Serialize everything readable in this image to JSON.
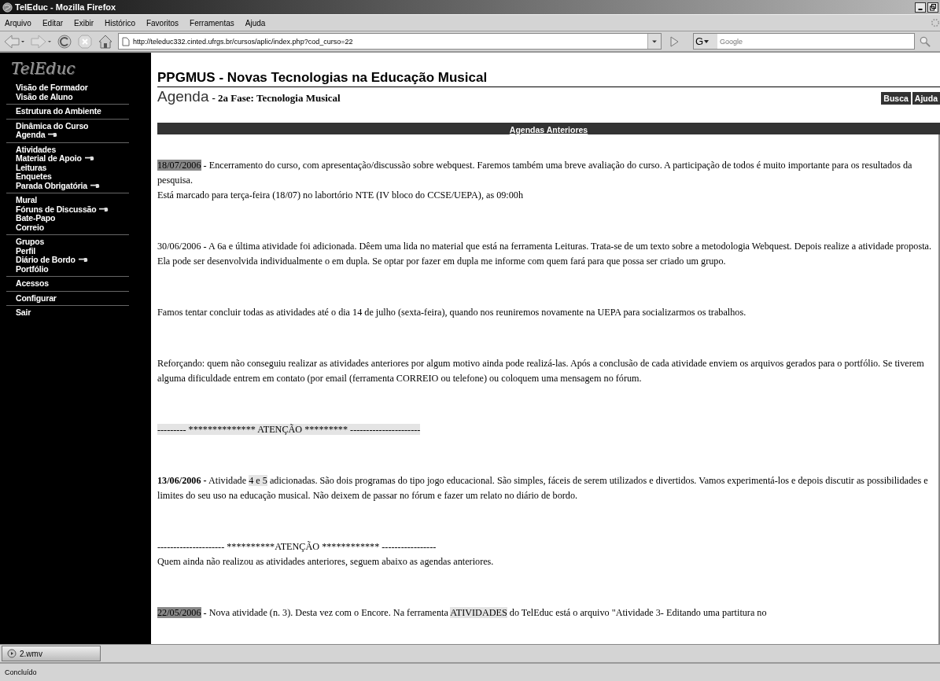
{
  "window": {
    "title": "TelEduc - Mozilla Firefox"
  },
  "menu": [
    "Arquivo",
    "Editar",
    "Exibir",
    "Histórico",
    "Favoritos",
    "Ferramentas",
    "Ajuda"
  ],
  "address": {
    "value": "http://teleduc332.cinted.ufrgs.br/cursos/aplic/index.php?cod_curso=22"
  },
  "search": {
    "engine": "G",
    "placeholder": "Google"
  },
  "sidebar": {
    "logo": "TelEduc",
    "groups": [
      [
        {
          "label": "Visão de Formador",
          "marked": false
        },
        {
          "label": "Visão de Aluno",
          "marked": false
        }
      ],
      [
        {
          "label": "Estrutura do Ambiente",
          "marked": false
        }
      ],
      [
        {
          "label": "Dinâmica do Curso",
          "marked": false
        },
        {
          "label": "Agenda",
          "marked": true
        }
      ],
      [
        {
          "label": "Atividades",
          "marked": false
        },
        {
          "label": "Material de Apoio",
          "marked": true
        },
        {
          "label": "Leituras",
          "marked": false
        },
        {
          "label": "Enquetes",
          "marked": false
        },
        {
          "label": "Parada Obrigatória",
          "marked": true
        }
      ],
      [
        {
          "label": "Mural",
          "marked": false
        },
        {
          "label": "Fóruns de Discussão",
          "marked": true
        },
        {
          "label": "Bate-Papo",
          "marked": false
        },
        {
          "label": "Correio",
          "marked": false
        }
      ],
      [
        {
          "label": "Grupos",
          "marked": false
        },
        {
          "label": "Perfil",
          "marked": false
        },
        {
          "label": "Diário de Bordo",
          "marked": true
        },
        {
          "label": "Portfólio",
          "marked": false
        }
      ],
      [
        {
          "label": "Acessos",
          "marked": false
        }
      ],
      [
        {
          "label": "Configurar",
          "marked": false
        }
      ],
      [
        {
          "label": "Sair",
          "marked": false
        }
      ]
    ]
  },
  "course_title": "PPGMUS - Novas Tecnologias na Educação Musical",
  "page_title": "Agenda",
  "page_subtitle": "- 2a Fase: Tecnologia Musical",
  "header_buttons": [
    "Busca",
    "Ajuda"
  ],
  "section_bar": "Agendas Anteriores",
  "entries": [
    {
      "lines": [
        [
          {
            "text": "18/07/2006",
            "bold": false,
            "highlighted": true,
            "shaded": false
          },
          {
            "text": " - Encerramento do curso, com apresentação/discussão sobre webquest. Faremos também uma breve avaliação do curso. A participação de todos é muito importante para os resultados da pesquisa.",
            "bold": false,
            "highlighted": false,
            "shaded": false
          }
        ],
        [
          {
            "text": "Está marcado para terça-feira (18/07) no labortório NTE (IV bloco do CCSE/UEPA), as 09:00h",
            "bold": false,
            "highlighted": false,
            "shaded": false
          }
        ]
      ]
    },
    {
      "lines": [
        [
          {
            "text": "30/06/2006 - A 6a e última atividade foi adicionada. Dêem uma lida no material que está na ferramenta Leituras. Trata-se de um texto sobre  a metodologia Webquest. Depois realize a atividade proposta. Ela pode ser desenvolvida individualmente o em dupla. Se optar por fazer em dupla me informe com quem fará para que possa ser criado um grupo.",
            "bold": false,
            "highlighted": false,
            "shaded": false
          }
        ]
      ]
    },
    {
      "lines": [
        [
          {
            "text": "Famos tentar concluir todas as atividades até o dia 14 de julho (sexta-feira), quando nos reuniremos novamente na UEPA para socializarmos os trabalhos.",
            "bold": false,
            "highlighted": false,
            "shaded": false
          }
        ]
      ]
    },
    {
      "lines": [
        [
          {
            "text": "Reforçando:  quem não conseguiu realizar as atividades anteriores por algum motivo ainda pode realizá-las. Após a conclusão de cada atividade enviem os arquivos gerados para  o portfólio. Se tiverem alguma dificuldade entrem em contato (por email (ferramenta CORREIO ou telefone) ou coloquem uma mensagem no fórum.",
            "bold": false,
            "highlighted": false,
            "shaded": false
          }
        ]
      ]
    },
    {
      "lines": [
        [
          {
            "text": "--------- ************** ATENÇÃO ********* ----------------------",
            "bold": false,
            "highlighted": false,
            "shaded": true
          }
        ]
      ]
    },
    {
      "lines": [
        [
          {
            "text": "13/06/2006 -",
            "bold": true,
            "highlighted": false,
            "shaded": false
          },
          {
            "text": "  Atividade ",
            "bold": false,
            "highlighted": false,
            "shaded": false
          },
          {
            "text": "4 e 5",
            "bold": false,
            "highlighted": false,
            "shaded": true
          },
          {
            "text": " adicionadas. São dois programas do tipo jogo educacional. São simples, fáceis de serem utilizados e divertidos. Vamos experimentá-los e depois discutir as possibilidades e limites do seu uso na educação musical. Não deixem de passar no fórum e fazer um relato no diário de bordo.",
            "bold": false,
            "highlighted": false,
            "shaded": false
          }
        ]
      ]
    },
    {
      "lines": [
        [
          {
            "text": "--------------------- **********ATENÇÃO ************ -----------------",
            "bold": false,
            "highlighted": false,
            "shaded": false
          }
        ],
        [
          {
            "text": "Quem ainda não realizou as atividades anteriores, seguem abaixo as agendas anteriores.",
            "bold": false,
            "highlighted": false,
            "shaded": false
          }
        ]
      ]
    },
    {
      "lines": [
        [
          {
            "text": "22/05/2006",
            "bold": false,
            "highlighted": true,
            "shaded": false
          },
          {
            "text": " - Nova atividade (n. 3). Desta vez com o Encore. Na ferramenta ",
            "bold": false,
            "highlighted": false,
            "shaded": false
          },
          {
            "text": "ATIVIDADES",
            "bold": false,
            "highlighted": false,
            "shaded": true
          },
          {
            "text": " do TelEduc está o arquivo \"Atividade 3- Editando uma partitura no",
            "bold": false,
            "highlighted": false,
            "shaded": false
          }
        ]
      ]
    }
  ],
  "taskbar": [
    {
      "label": "2.wmv"
    }
  ],
  "status_bar": "Concluído"
}
